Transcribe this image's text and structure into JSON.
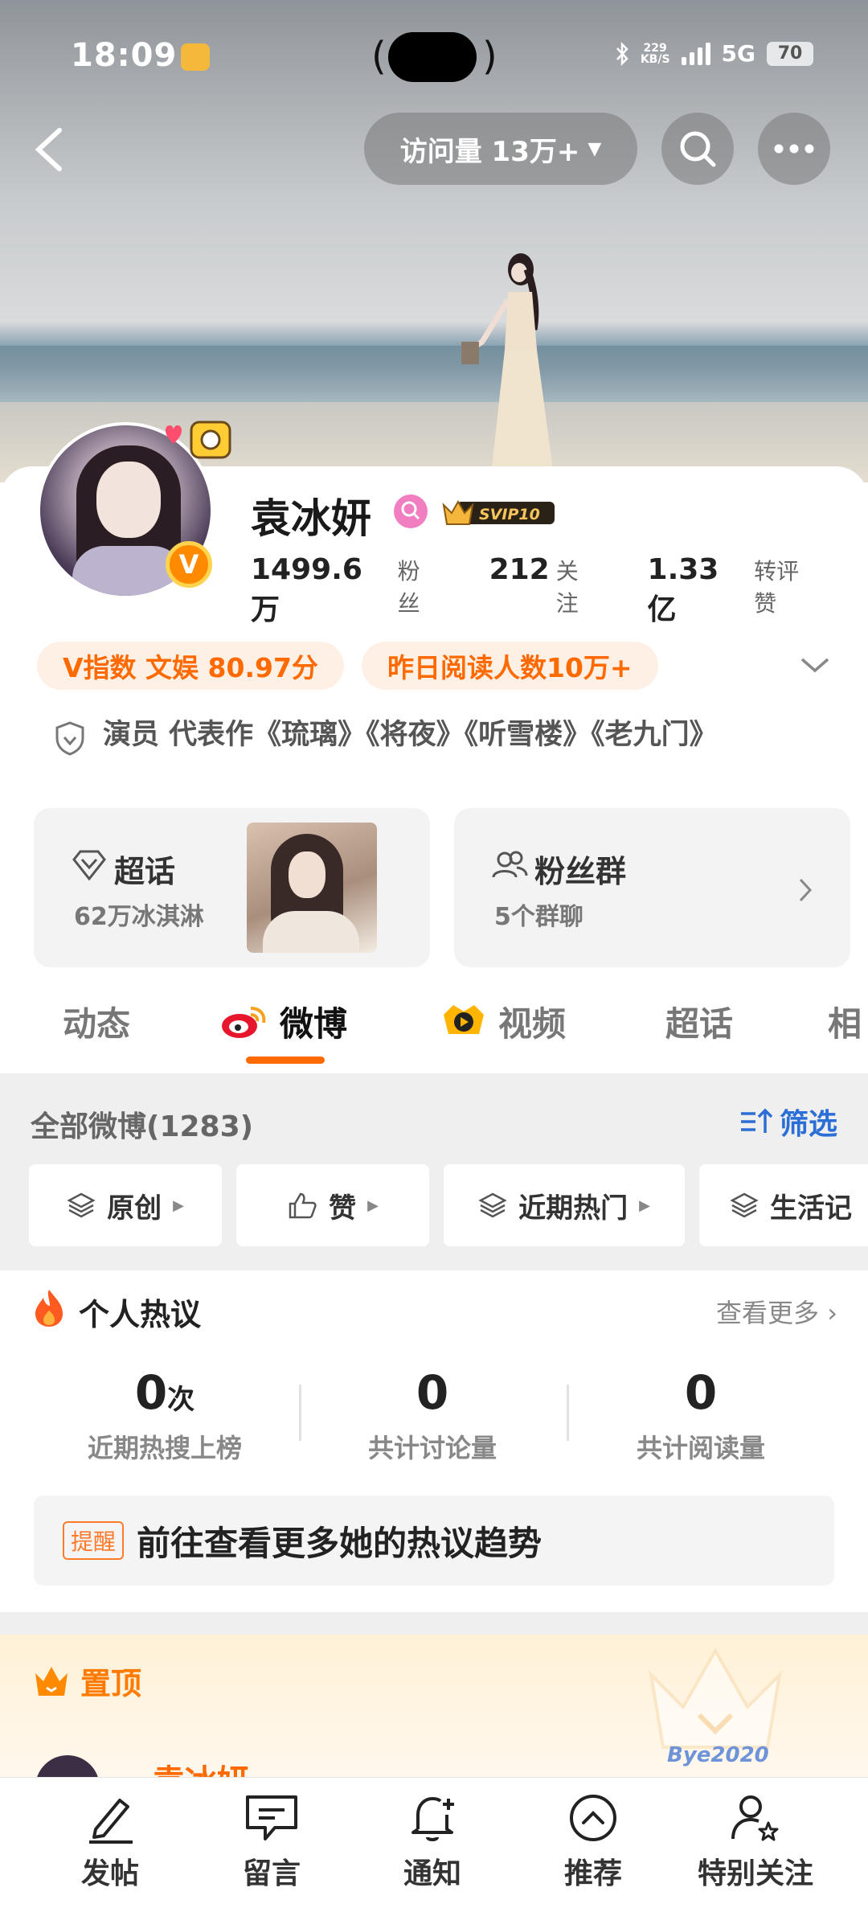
{
  "status_bar": {
    "time": "18:09",
    "net_speed_value": "229",
    "net_speed_unit": "KB/S",
    "network": "5G",
    "battery": "70"
  },
  "nav": {
    "visits_label": "访问量 13万+"
  },
  "profile": {
    "name": "袁冰妍",
    "svip_badge": "SVIP10",
    "stats": [
      {
        "value": "1499.6万",
        "label": "粉丝"
      },
      {
        "value": "212",
        "label": "关注"
      },
      {
        "value": "1.33亿",
        "label": "转评赞"
      }
    ],
    "v_index": "V指数 文娱 80.97分",
    "yesterday_reads": "昨日阅读人数10万+",
    "bio": "演员 代表作《琉璃》《将夜》《听雪楼》《老九门》"
  },
  "boxes": {
    "chaohua": {
      "title": "超话",
      "sub": "62万冰淇淋"
    },
    "fans_group": {
      "title": "粉丝群",
      "sub": "5个群聊"
    }
  },
  "tabs": [
    {
      "label": "动态"
    },
    {
      "label": "微博"
    },
    {
      "label": "视频"
    },
    {
      "label": "超话"
    },
    {
      "label": "相"
    }
  ],
  "feed": {
    "all_label": "全部微博(1283)",
    "filter_label": "筛选",
    "chips": [
      "原创",
      "赞",
      "近期热门",
      "生活记"
    ]
  },
  "hot_discussion": {
    "title": "个人热议",
    "see_more": "查看更多",
    "metrics": [
      {
        "value": "0",
        "unit": "次",
        "label": "近期热搜上榜"
      },
      {
        "value": "0",
        "unit": "",
        "label": "共计讨论量"
      },
      {
        "value": "0",
        "unit": "",
        "label": "共计阅读量"
      }
    ],
    "reminder_tag": "提醒",
    "reminder_text": "前往查看更多她的热议趋势"
  },
  "pinned": {
    "label": "置顶",
    "author": "袁冰妍",
    "sticker_text": "Bye2020"
  },
  "bottom_bar": [
    {
      "label": "发帖",
      "icon": "pen-icon"
    },
    {
      "label": "留言",
      "icon": "chat-icon"
    },
    {
      "label": "通知",
      "icon": "bell-plus-icon"
    },
    {
      "label": "推荐",
      "icon": "up-circle-icon"
    },
    {
      "label": "特别关注",
      "icon": "user-star-icon"
    }
  ],
  "colors": {
    "accent_orange": "#ff6a00",
    "link_blue": "#2b6fd6"
  }
}
